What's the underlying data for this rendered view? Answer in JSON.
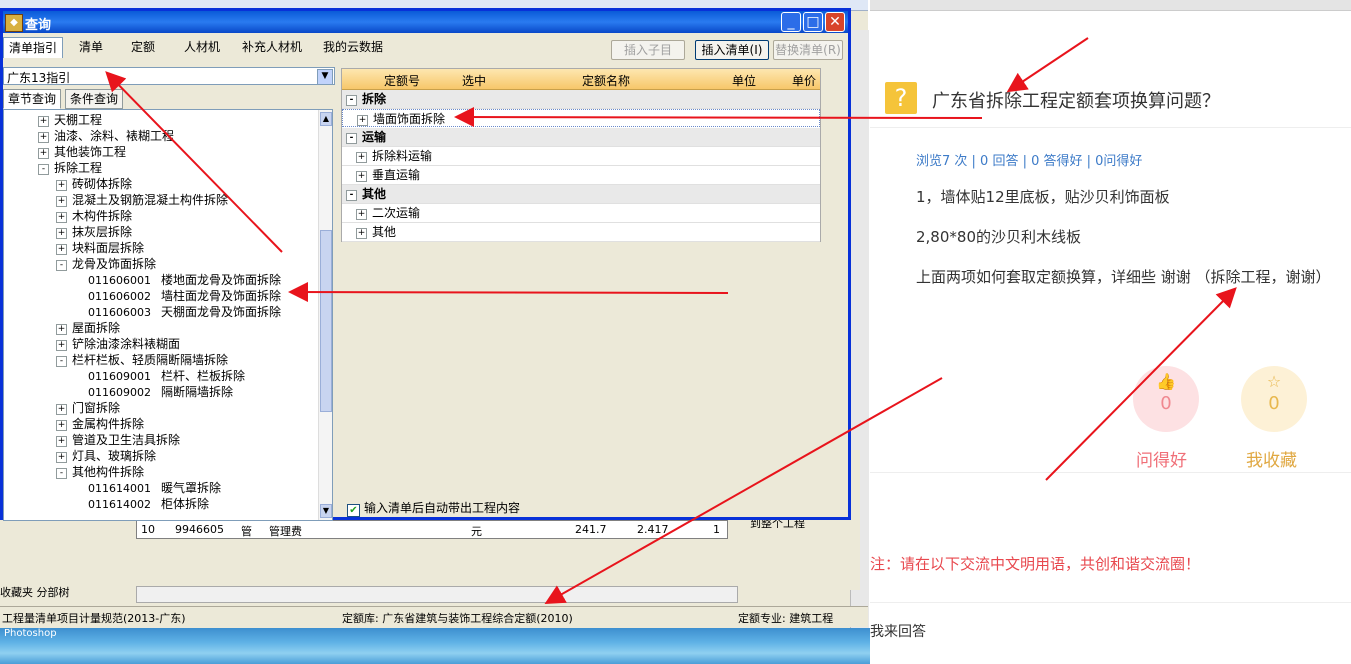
{
  "dialog": {
    "title": "查询",
    "window_buttons": {
      "minimize": "_",
      "maximize": "□",
      "close": "✕"
    },
    "tabs": [
      "清单指引",
      "清单",
      "定额",
      "人材机",
      "补充人材机",
      "我的云数据"
    ],
    "active_tab": "清单指引",
    "actions": {
      "insert_child": "插入子目",
      "insert_list": "插入清单(I)",
      "replace_list": "替换清单(R)"
    },
    "combo_value": "广东13指引",
    "subtabs": [
      "章节查询",
      "条件查询"
    ],
    "auto_check_label": "输入清单后自动带出工程内容"
  },
  "tree": {
    "nodes": [
      {
        "level": 1,
        "exp": "+",
        "code": "",
        "label": "天棚工程"
      },
      {
        "level": 1,
        "exp": "+",
        "code": "",
        "label": "油漆、涂料、裱糊工程"
      },
      {
        "level": 1,
        "exp": "+",
        "code": "",
        "label": "其他装饰工程"
      },
      {
        "level": 1,
        "exp": "-",
        "code": "",
        "label": "拆除工程"
      },
      {
        "level": 2,
        "exp": "+",
        "code": "",
        "label": "砖砌体拆除"
      },
      {
        "level": 2,
        "exp": "+",
        "code": "",
        "label": "混凝土及钢筋混凝土构件拆除"
      },
      {
        "level": 2,
        "exp": "+",
        "code": "",
        "label": "木构件拆除"
      },
      {
        "level": 2,
        "exp": "+",
        "code": "",
        "label": "抹灰层拆除"
      },
      {
        "level": 2,
        "exp": "+",
        "code": "",
        "label": "块料面层拆除"
      },
      {
        "level": 2,
        "exp": "-",
        "code": "",
        "label": "龙骨及饰面拆除"
      },
      {
        "level": 3,
        "exp": "",
        "code": "011606001",
        "label": "楼地面龙骨及饰面拆除"
      },
      {
        "level": 3,
        "exp": "",
        "code": "011606002",
        "label": "墙柱面龙骨及饰面拆除"
      },
      {
        "level": 3,
        "exp": "",
        "code": "011606003",
        "label": "天棚面龙骨及饰面拆除"
      },
      {
        "level": 2,
        "exp": "+",
        "code": "",
        "label": "屋面拆除"
      },
      {
        "level": 2,
        "exp": "+",
        "code": "",
        "label": "铲除油漆涂料裱糊面"
      },
      {
        "level": 2,
        "exp": "-",
        "code": "",
        "label": "栏杆栏板、轻质隔断隔墙拆除"
      },
      {
        "level": 3,
        "exp": "",
        "code": "011609001",
        "label": "栏杆、栏板拆除"
      },
      {
        "level": 3,
        "exp": "",
        "code": "011609002",
        "label": "隔断隔墙拆除"
      },
      {
        "level": 2,
        "exp": "+",
        "code": "",
        "label": "门窗拆除"
      },
      {
        "level": 2,
        "exp": "+",
        "code": "",
        "label": "金属构件拆除"
      },
      {
        "level": 2,
        "exp": "+",
        "code": "",
        "label": "管道及卫生洁具拆除"
      },
      {
        "level": 2,
        "exp": "+",
        "code": "",
        "label": "灯具、玻璃拆除"
      },
      {
        "level": 2,
        "exp": "-",
        "code": "",
        "label": "其他构件拆除"
      },
      {
        "level": 3,
        "exp": "",
        "code": "011614001",
        "label": "暖气罩拆除"
      },
      {
        "level": 3,
        "exp": "",
        "code": "011614002",
        "label": "柜体拆除"
      }
    ]
  },
  "grid": {
    "headers": [
      "定额号",
      "选中",
      "定额名称",
      "单位",
      "单价"
    ],
    "rows": [
      {
        "type": "group",
        "exp": "-",
        "label": "拆除"
      },
      {
        "type": "item",
        "exp": "+",
        "label": "墙面饰面拆除"
      },
      {
        "type": "group",
        "exp": "-",
        "label": "运输"
      },
      {
        "type": "item",
        "exp": "+",
        "label": "拆除料运输"
      },
      {
        "type": "item",
        "exp": "+",
        "label": "垂直运输"
      },
      {
        "type": "group",
        "exp": "-",
        "label": "其他"
      },
      {
        "type": "item",
        "exp": "+",
        "label": "二次运输"
      },
      {
        "type": "item",
        "exp": "+",
        "label": "其他"
      }
    ]
  },
  "background": {
    "row": {
      "num": "10",
      "code": "9946605",
      "kind": "管",
      "name": "管理费",
      "unit": "元",
      "v1": "241.7",
      "v2": "2.417",
      "v3": "1"
    },
    "tabs_text": "收藏夹 分部树",
    "status_left": "工程量清单项目计量规范(2013-广东)",
    "status_mid": "定额库: 广东省建筑与装饰工程综合定额(2010)",
    "status_right": "定额专业: 建筑工程",
    "sync_label": "修改市场价同步到整个工程",
    "desktop_label": "Photoshop"
  },
  "web": {
    "title": "广东省拆除工程定额套项换算问题？",
    "stats": "浏览7 次 | 0 回答 | 0 答得好 | 0问得好",
    "lines": [
      "1，墙体贴12里底板，贴沙贝利饰面板",
      "2,80*80的沙贝利木线板",
      "上面两项如何套取定额换算，详细些 谢谢 （拆除工程，谢谢）"
    ],
    "like": {
      "count": "0",
      "label": "问得好"
    },
    "fav": {
      "count": "0",
      "label": "我收藏"
    },
    "notice": "注：请在以下交流中文明用语，共创和谐交流圈！",
    "answer_label": "我来回答"
  },
  "colors": {
    "arrow": "#e8141c",
    "title_bar": "#0a5bd8",
    "grid_header": "#f7c76a",
    "like": "#f06f78",
    "fav": "#e0a842"
  }
}
